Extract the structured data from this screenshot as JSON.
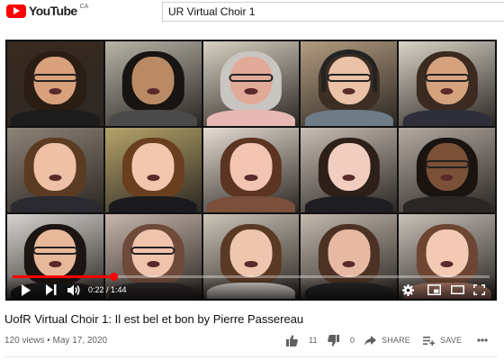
{
  "header": {
    "logo_text": "YouTube",
    "logo_region": "CA",
    "search_value": "UR Virtual Choir 1"
  },
  "player": {
    "current_time": "0:22",
    "duration": "1:44",
    "time_display": "0:22 / 1:44",
    "progress_fraction": 0.212,
    "tiles": [
      {
        "bg": "#3a2a20",
        "hair": "#2a1d14",
        "skin": "#d9a07c",
        "shirt": "#1c1c1c",
        "glasses": true,
        "headphones": false
      },
      {
        "bg": "#b8b4a8",
        "hair": "#171412",
        "skin": "#b98a64",
        "shirt": "#4a4a4a",
        "glasses": false,
        "headphones": false
      },
      {
        "bg": "#d8d1c3",
        "hair": "#c9c6c1",
        "skin": "#e1aa98",
        "shirt": "#e8b8b4",
        "glasses": true,
        "headphones": false
      },
      {
        "bg": "#b39c80",
        "hair": "#3d2d22",
        "skin": "#e9c2a8",
        "shirt": "#6d7c86",
        "glasses": true,
        "headphones": true
      },
      {
        "bg": "#d9d4c8",
        "hair": "#3b2a20",
        "skin": "#d6a27e",
        "shirt": "#2f2f3a",
        "glasses": true,
        "headphones": false
      },
      {
        "bg": "#8f8378",
        "hair": "#5b3c22",
        "skin": "#eec1a6",
        "shirt": "#2a2a30",
        "glasses": false,
        "headphones": false
      },
      {
        "bg": "#b5a46a",
        "hair": "#6a3f20",
        "skin": "#f0c7ad",
        "shirt": "#1a1a1e",
        "glasses": false,
        "headphones": false
      },
      {
        "bg": "#e6ddd2",
        "hair": "#5c3522",
        "skin": "#f2c4b1",
        "shirt": "#7a4f3c",
        "glasses": false,
        "headphones": false
      },
      {
        "bg": "#c8bdb4",
        "hair": "#2e1f19",
        "skin": "#f1cdbf",
        "shirt": "#1d1d22",
        "glasses": false,
        "headphones": false
      },
      {
        "bg": "#b4aaa2",
        "hair": "#1a1411",
        "skin": "#7a5037",
        "shirt": "#2a2626",
        "glasses": true,
        "headphones": false
      },
      {
        "bg": "#d7d4d0",
        "hair": "#1c1512",
        "skin": "#e7b899",
        "shirt": "#1d1d1d",
        "glasses": true,
        "headphones": false
      },
      {
        "bg": "#c7b6ac",
        "hair": "#6e4a3a",
        "skin": "#f0c3ad",
        "shirt": "#322d2d",
        "glasses": true,
        "headphones": false
      },
      {
        "bg": "#cdc5b9",
        "hair": "#5a3a24",
        "skin": "#eec6ae",
        "shirt": "#dcd6d0",
        "glasses": false,
        "headphones": false
      },
      {
        "bg": "#c3b9ae",
        "hair": "#4c3224",
        "skin": "#e8b9a2",
        "shirt": "#2a2a2a",
        "glasses": false,
        "headphones": false
      },
      {
        "bg": "#c8c0b8",
        "hair": "#6c4632",
        "skin": "#f3c9b4",
        "shirt": "#b47f6d",
        "glasses": false,
        "headphones": false
      }
    ]
  },
  "video": {
    "title": "UofR Virtual Choir 1: Il est bel et bon by Pierre Passereau",
    "meta": "120 views • May 17, 2020"
  },
  "actions": {
    "likes": "11",
    "dislikes": "0",
    "share_label": "SHARE",
    "save_label": "SAVE"
  },
  "colors": {
    "brand_red": "#ff0000",
    "text_secondary": "#606060"
  },
  "icons": [
    "play-icon",
    "next-icon",
    "volume-icon",
    "settings-icon",
    "miniplayer-icon",
    "theater-icon",
    "fullscreen-icon",
    "thumbs-up-icon",
    "thumbs-down-icon",
    "share-icon",
    "save-icon",
    "more-icon"
  ]
}
